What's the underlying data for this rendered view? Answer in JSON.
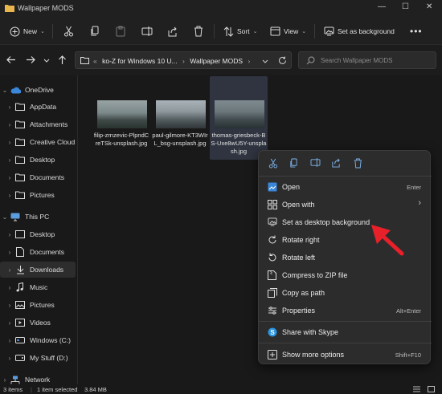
{
  "window": {
    "title": "Wallpaper MODS"
  },
  "toolbar": {
    "new_label": "New",
    "sort_label": "Sort",
    "view_label": "View",
    "set_bg_label": "Set as background"
  },
  "address": {
    "overflow": "«",
    "crumbs": [
      "ko-Z for Windows 10 U...",
      "Wallpaper MODS"
    ]
  },
  "search": {
    "placeholder": "Search Wallpaper MODS"
  },
  "sidebar": {
    "items": [
      {
        "label": "OneDrive",
        "icon": "cloud-icon"
      },
      {
        "label": "AppData",
        "icon": "folder-icon"
      },
      {
        "label": "Attachments",
        "icon": "folder-icon"
      },
      {
        "label": "Creative Cloud",
        "icon": "folder-icon"
      },
      {
        "label": "Desktop",
        "icon": "folder-icon"
      },
      {
        "label": "Documents",
        "icon": "folder-icon"
      },
      {
        "label": "Pictures",
        "icon": "folder-icon"
      },
      {
        "label": "This PC",
        "icon": "monitor-icon"
      },
      {
        "label": "Desktop",
        "icon": "desktop-icon"
      },
      {
        "label": "Documents",
        "icon": "documents-icon"
      },
      {
        "label": "Downloads",
        "icon": "download-icon"
      },
      {
        "label": "Music",
        "icon": "music-icon"
      },
      {
        "label": "Pictures",
        "icon": "pictures-icon"
      },
      {
        "label": "Videos",
        "icon": "videos-icon"
      },
      {
        "label": "Windows (C:)",
        "icon": "drive-icon"
      },
      {
        "label": "My Stuff (D:)",
        "icon": "drive-icon"
      },
      {
        "label": "Network",
        "icon": "network-icon"
      }
    ]
  },
  "files": [
    {
      "name": "filip-zrnzevic-PlpndCreTSk-unsplash.jpg"
    },
    {
      "name": "paul-gilmore-KT3WIrL_bsg-unsplash.jpg"
    },
    {
      "name": "thomas-griesbeck-BS-Uxe8wU5Y-unsplash.jpg"
    }
  ],
  "context_menu": {
    "items": [
      {
        "label": "Open",
        "shortcut": "Enter"
      },
      {
        "label": "Open with",
        "shortcut": "›"
      },
      {
        "label": "Set as desktop background",
        "shortcut": ""
      },
      {
        "label": "Rotate right",
        "shortcut": ""
      },
      {
        "label": "Rotate left",
        "shortcut": ""
      },
      {
        "label": "Compress to ZIP file",
        "shortcut": ""
      },
      {
        "label": "Copy as path",
        "shortcut": ""
      },
      {
        "label": "Properties",
        "shortcut": "Alt+Enter"
      },
      {
        "label": "Share with Skype",
        "shortcut": ""
      },
      {
        "label": "Show more options",
        "shortcut": "Shift+F10"
      }
    ]
  },
  "status": {
    "items_count": "3 items",
    "selection": "1 item selected",
    "size": "3.84 MB"
  },
  "colors": {
    "accent": "#4c8bd6",
    "folder": "#e8b64c",
    "arrow": "#e8202a",
    "menu_bg": "#2c2c2c",
    "window_bg": "#191919"
  }
}
